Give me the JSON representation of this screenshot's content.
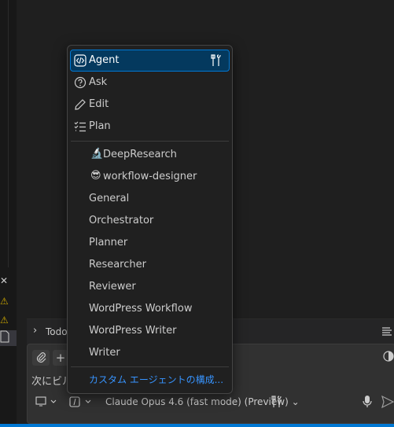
{
  "sidebar": {
    "icons": [
      "close-icon",
      "warning-icon",
      "warning-icon",
      "file-icon"
    ]
  },
  "todo": {
    "label": "Todo"
  },
  "input": {
    "text": "次にビルドを"
  },
  "toolbar": {
    "model_label": "Claude Opus 4.6 (fast mode) (Preview)"
  },
  "menu": {
    "modes": [
      {
        "label": "Agent",
        "icon": "agent-icon",
        "active": true
      },
      {
        "label": "Ask",
        "icon": "question-icon"
      },
      {
        "label": "Edit",
        "icon": "pencil-icon"
      },
      {
        "label": "Plan",
        "icon": "checklist-icon"
      }
    ],
    "emoji_agents": [
      {
        "emoji": "🔬",
        "label": "DeepResearch"
      },
      {
        "emoji": "😎",
        "label": "workflow-designer"
      }
    ],
    "agents": [
      "General",
      "Orchestrator",
      "Planner",
      "Researcher",
      "Reviewer",
      "WordPress Workflow",
      "WordPress Writer",
      "Writer"
    ],
    "configure_label": "カスタム エージェントの構成..."
  },
  "colors": {
    "accent": "#0078d4",
    "link": "#3794ff",
    "warning": "#cca700",
    "active_bg": "#04395e"
  }
}
